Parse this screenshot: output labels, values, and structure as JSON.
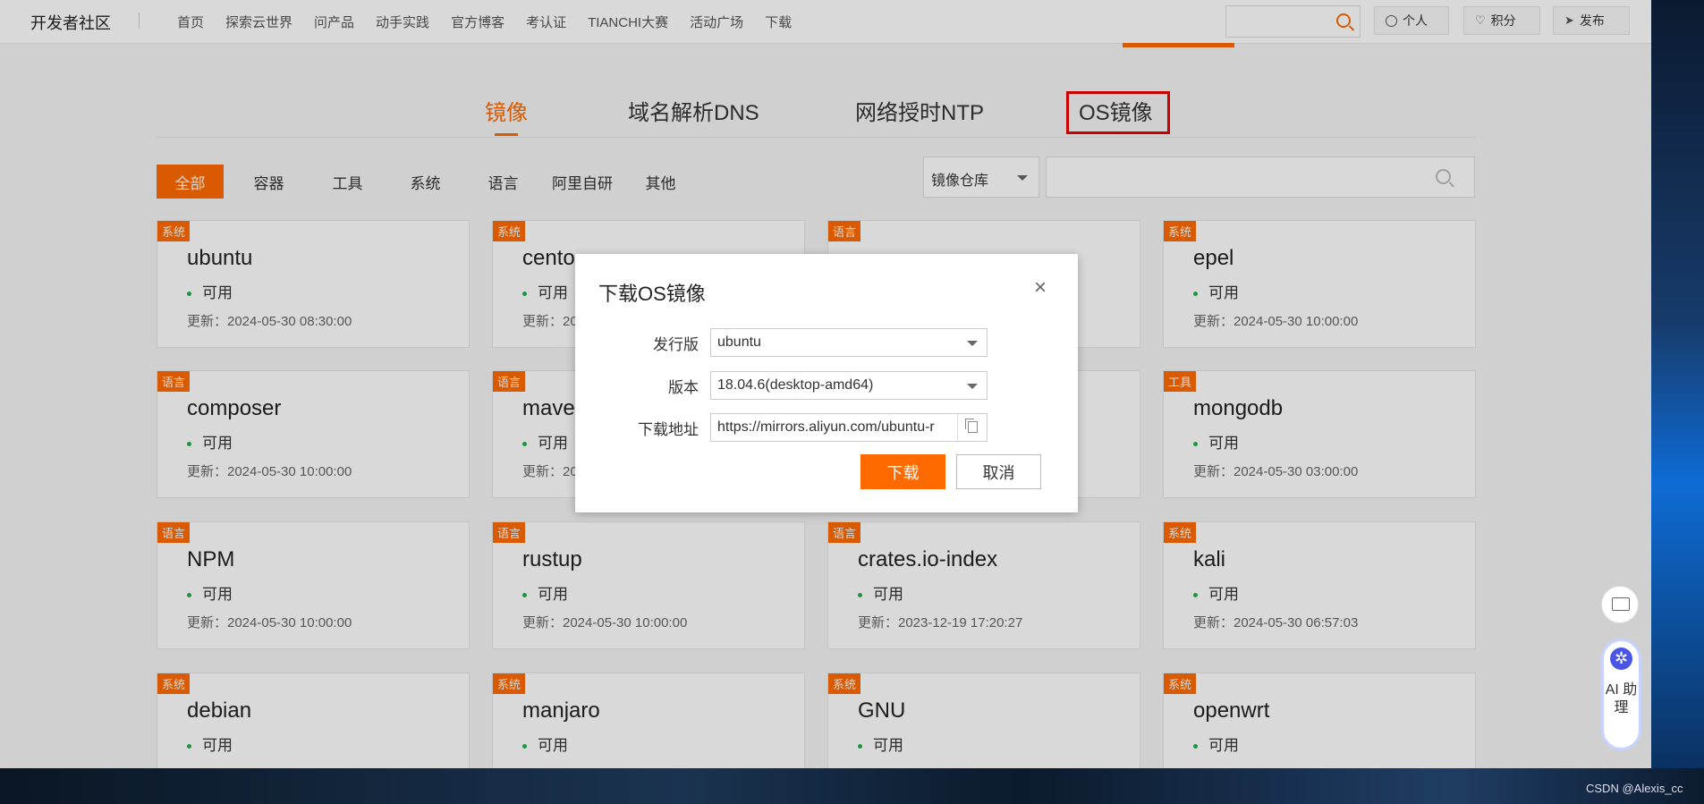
{
  "topnav": {
    "logo": "开发者社区",
    "links": [
      "首页",
      "探索云世界",
      "问产品",
      "动手实践",
      "官方博客",
      "考认证",
      "TIANCHI大赛",
      "活动广场",
      "下载"
    ],
    "personal": "个人",
    "points": "积分",
    "publish": "发布"
  },
  "tabs": [
    "镜像",
    "域名解析DNS",
    "网络授时NTP",
    "OS镜像"
  ],
  "categories": [
    "全部",
    "容器",
    "工具",
    "系统",
    "语言",
    "阿里自研",
    "其他"
  ],
  "repo_select": "镜像仓库",
  "cards": [
    {
      "tag": "系统",
      "name": "ubuntu",
      "status": "可用",
      "updated": "更新：2024-05-30 08:30:00"
    },
    {
      "tag": "系统",
      "name": "cento",
      "status": "可用",
      "updated": "更新：20"
    },
    {
      "tag": "语言",
      "name": "",
      "status": "",
      "updated": ""
    },
    {
      "tag": "系统",
      "name": "epel",
      "status": "可用",
      "updated": "更新：2024-05-30 10:00:00"
    },
    {
      "tag": "语言",
      "name": "composer",
      "status": "可用",
      "updated": "更新：2024-05-30 10:00:00"
    },
    {
      "tag": "语言",
      "name": "mave",
      "status": "可用",
      "updated": "更新：20"
    },
    {
      "tag": "",
      "name": "",
      "status": "",
      "updated": ""
    },
    {
      "tag": "工具",
      "name": "mongodb",
      "status": "可用",
      "updated": "更新：2024-05-30 03:00:00"
    },
    {
      "tag": "语言",
      "name": "NPM",
      "status": "可用",
      "updated": "更新：2024-05-30 10:00:00"
    },
    {
      "tag": "语言",
      "name": "rustup",
      "status": "可用",
      "updated": "更新：2024-05-30 10:00:00"
    },
    {
      "tag": "语言",
      "name": "crates.io-index",
      "status": "可用",
      "updated": "更新：2023-12-19 17:20:27"
    },
    {
      "tag": "系统",
      "name": "kali",
      "status": "可用",
      "updated": "更新：2024-05-30 06:57:03"
    },
    {
      "tag": "系统",
      "name": "debian",
      "status": "可用",
      "updated": ""
    },
    {
      "tag": "系统",
      "name": "manjaro",
      "status": "可用",
      "updated": ""
    },
    {
      "tag": "系统",
      "name": "GNU",
      "status": "可用",
      "updated": ""
    },
    {
      "tag": "系统",
      "name": "openwrt",
      "status": "可用",
      "updated": ""
    }
  ],
  "dialog": {
    "title": "下载OS镜像",
    "close": "×",
    "distro_label": "发行版",
    "distro_value": "ubuntu",
    "version_label": "版本",
    "version_value": "18.04.6(desktop-amd64)",
    "url_label": "下载地址",
    "url_value": "https://mirrors.aliyun.com/ubuntu-r",
    "download": "下载",
    "cancel": "取消"
  },
  "ai_assistant": "AI 助 理",
  "watermark": "CSDN @Alexis_cc"
}
